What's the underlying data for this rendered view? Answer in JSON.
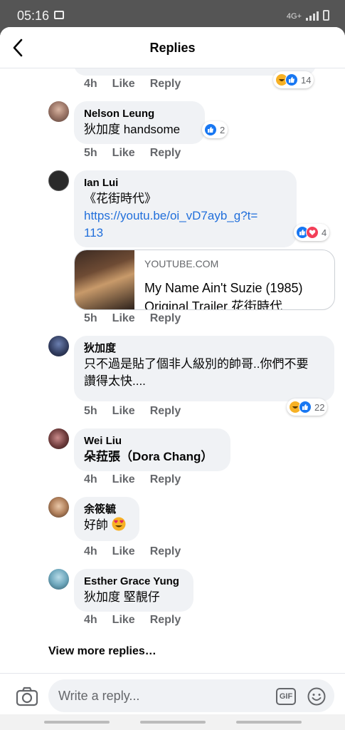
{
  "status_bar": {
    "time": "05:16",
    "network": "4G+"
  },
  "header": {
    "title": "Replies"
  },
  "top_comment": {
    "time": "4h",
    "like_label": "Like",
    "reply_label": "Reply",
    "reaction_count": "14"
  },
  "comments": [
    {
      "name": "Nelson Leung",
      "text": "狄加度 handsome",
      "time": "5h",
      "like_label": "Like",
      "reply_label": "Reply",
      "reaction_count": "2"
    },
    {
      "name": "Ian Lui",
      "text": "《花街時代》",
      "link_line1": "https://youtu.be/oi_vD7ayb_g?t=",
      "link_line2": "113",
      "time": "5h",
      "like_label": "Like",
      "reply_label": "Reply",
      "reaction_count": "4",
      "preview": {
        "domain": "YOUTUBE.COM",
        "title": "My Name Ain't Suzie (1985) Original Trailer 花街時代"
      }
    },
    {
      "name": "狄加度",
      "text_line1": "只不過是貼了個非人級別的帥哥..你們不要",
      "text_line2": "讚得太快....",
      "time": "5h",
      "like_label": "Like",
      "reply_label": "Reply",
      "reaction_count": "22"
    },
    {
      "name": "Wei Liu",
      "text": "朵菈張（Dora Chang）",
      "time": "4h",
      "like_label": "Like",
      "reply_label": "Reply"
    },
    {
      "name": "余筱毓",
      "text": "好帥",
      "time": "4h",
      "like_label": "Like",
      "reply_label": "Reply"
    },
    {
      "name": "Esther Grace Yung",
      "text": "狄加度 堅靚仔",
      "time": "4h",
      "like_label": "Like",
      "reply_label": "Reply"
    }
  ],
  "more_replies": "View more replies…",
  "composer": {
    "placeholder": "Write a reply...",
    "gif_label": "GIF"
  },
  "colors": {
    "link": "#216fdb",
    "like": "#1877f2",
    "love": "#f33e58",
    "haha": "#f7b125",
    "bubble": "#f0f2f5"
  }
}
